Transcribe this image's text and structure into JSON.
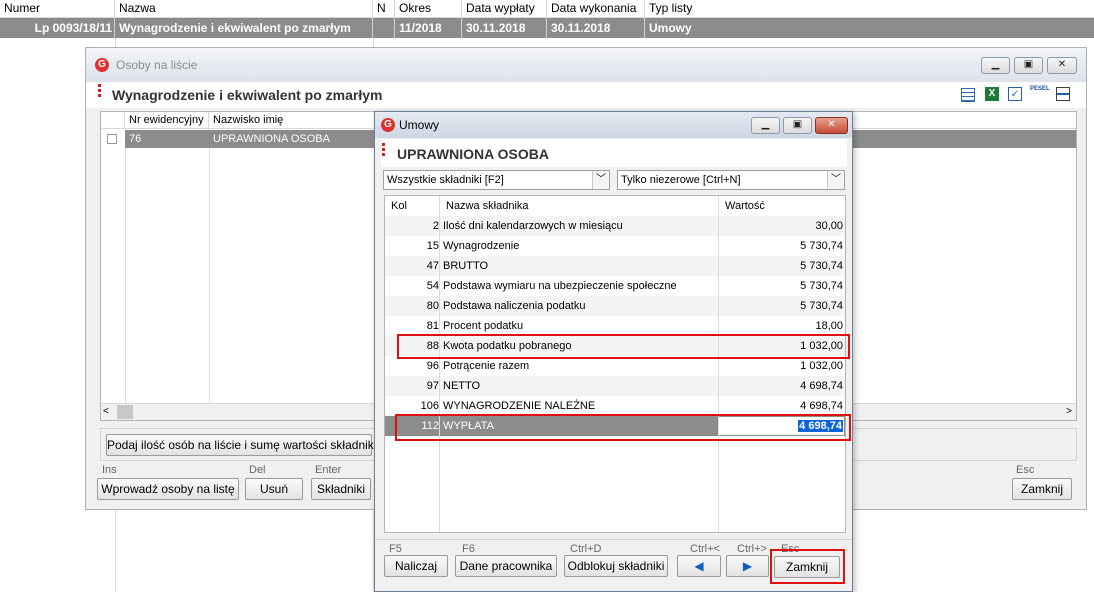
{
  "background": {
    "columns": [
      "Numer",
      "Nazwa",
      "N",
      "Okres",
      "Data wypłaty",
      "Data wykonania",
      "Typ listy"
    ],
    "row": {
      "numer": "Lp 0093/18/11",
      "nazwa": "Wynagrodzenie i ekwiwalent po zmarłym",
      "n": "",
      "okres": "11/2018",
      "data_wyplaty": "30.11.2018",
      "data_wykonania": "30.11.2018",
      "typ": "Umowy"
    }
  },
  "osoby_window": {
    "title": "Osoby na liście",
    "subtitle": "Wynagrodzenie i ekwiwalent po zmarłym",
    "columns": [
      "Nr ewidencyjny",
      "Nazwisko imię"
    ],
    "row": {
      "nr": "76",
      "name": "UPRAWNIONA OSOBA"
    },
    "summary_button": "Podaj ilość osób na liście i sumę wartości składników",
    "keys": {
      "ins": "Ins",
      "del": "Del",
      "enter": "Enter",
      "esc": "Esc"
    },
    "buttons": {
      "add": "Wprowadź osoby na listę",
      "delete": "Usuń",
      "components": "Składniki",
      "close": "Zamknij"
    },
    "toolbar_icons": [
      "table-icon",
      "excel-icon",
      "checkbox-icon",
      "pesel-icon",
      "print-icon"
    ],
    "pesel_label": "PESEL"
  },
  "umowy_dialog": {
    "title": "Umowy",
    "subtitle": "UPRAWNIONA OSOBA",
    "filter1": "Wszystkie składniki [F2]",
    "filter2": "Tylko niezerowe [Ctrl+N]",
    "columns": {
      "kol": "Kol",
      "name": "Nazwa składnika",
      "value": "Wartość"
    },
    "rows": [
      {
        "kol": "2",
        "name": "Ilość dni kalendarzowych w miesiącu",
        "value": "30,00"
      },
      {
        "kol": "15",
        "name": "Wynagrodzenie",
        "value": "5 730,74"
      },
      {
        "kol": "47",
        "name": "BRUTTO",
        "value": "5 730,74"
      },
      {
        "kol": "54",
        "name": "Podstawa wymiaru na ubezpieczenie społeczne",
        "value": "5 730,74"
      },
      {
        "kol": "80",
        "name": "Podstawa naliczenia podatku",
        "value": "5 730,74"
      },
      {
        "kol": "81",
        "name": "Procent podatku",
        "value": "18,00"
      },
      {
        "kol": "88",
        "name": "Kwota podatku pobranego",
        "value": "1 032,00"
      },
      {
        "kol": "96",
        "name": "Potrącenie razem",
        "value": "1 032,00"
      },
      {
        "kol": "97",
        "name": "NETTO",
        "value": "4 698,74"
      },
      {
        "kol": "106",
        "name": "WYNAGRODZENIE NALEŻNE",
        "value": "4 698,74"
      },
      {
        "kol": "112",
        "name": "WYPŁATA",
        "value": "4 698,74"
      }
    ],
    "keys": {
      "f5": "F5",
      "f6": "F6",
      "ctrld": "Ctrl+D",
      "ctrlprev": "Ctrl+<",
      "ctrlnext": "Ctrl+>",
      "esc": "Esc"
    },
    "buttons": {
      "calculate": "Naliczaj",
      "employee": "Dane pracownika",
      "unlock": "Odblokuj składniki",
      "prev": "◀",
      "next": "▶",
      "close": "Zamknij"
    }
  },
  "colors": {
    "selected_row": "#8c8c8c",
    "highlight": "#e01010",
    "edit_selection": "#0a64d8"
  }
}
